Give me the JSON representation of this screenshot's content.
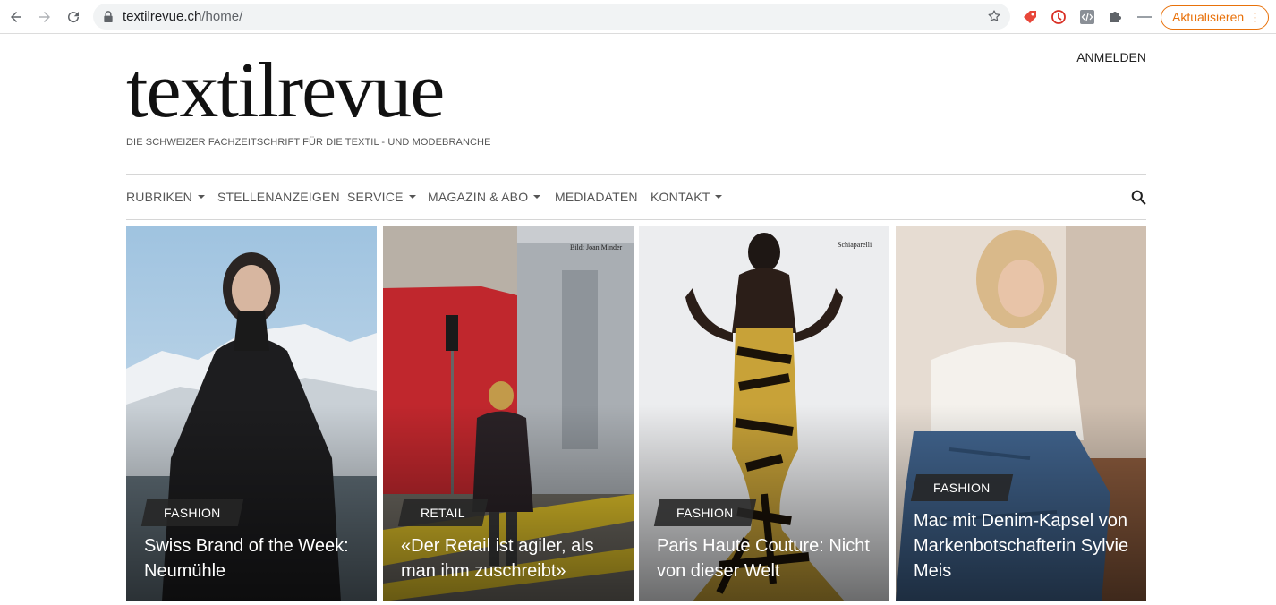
{
  "browser": {
    "url_domain": "textilrevue.ch",
    "url_path": "/home/",
    "update_label": "Aktualisieren",
    "menu_dots": "⋮"
  },
  "site": {
    "logo": "textilrevue",
    "tagline": "DIE SCHWEIZER FACHZEITSCHRIFT FÜR DIE TEXTIL - UND MODEBRANCHE",
    "login": "ANMELDEN",
    "menu": [
      {
        "label": "RUBRIKEN",
        "dropdown": true
      },
      {
        "label": "STELLENANZEIGEN",
        "dropdown": false
      },
      {
        "label": "SERVICE",
        "dropdown": true
      },
      {
        "label": "MAGAZIN & ABO",
        "dropdown": true
      },
      {
        "label": "MEDIADATEN",
        "dropdown": false
      },
      {
        "label": "KONTAKT",
        "dropdown": true
      }
    ]
  },
  "cards": [
    {
      "category": "FASHION",
      "title": "Swiss Brand of the Week: Neumühle",
      "credit": ""
    },
    {
      "category": "RETAIL",
      "title": "«Der Retail ist agiler, als man ihm zuschreibt»",
      "credit": "Bild: Joan Minder"
    },
    {
      "category": "FASHION",
      "title": "Paris Haute Couture: Nicht von dieser Welt",
      "credit": "Schiaparelli"
    },
    {
      "category": "FASHION",
      "title": "Mac mit Denim-Kapsel von Markenbotschafterin Sylvie Meis",
      "credit": ""
    }
  ],
  "colors": {
    "accent_update": "#e8710a",
    "badge_bg": "#262626"
  }
}
